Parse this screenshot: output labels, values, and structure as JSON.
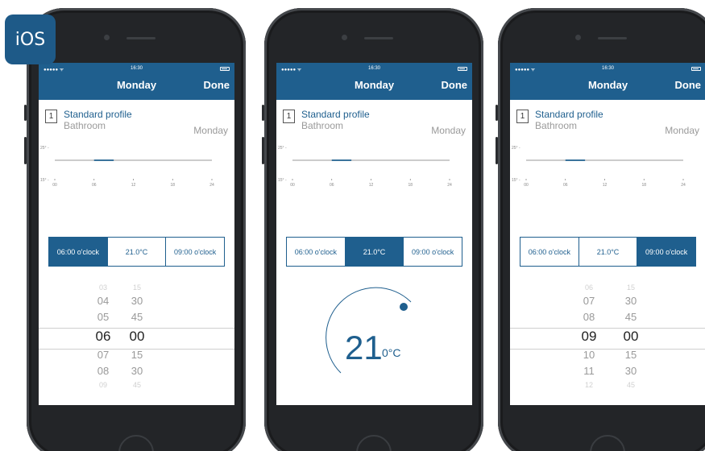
{
  "badge": {
    "label": "iOS"
  },
  "status_time": "16:30",
  "nav": {
    "title": "Monday",
    "done_label": "Done"
  },
  "profile": {
    "number": "1",
    "name": "Standard profile",
    "room": "Bathroom",
    "day": "Monday"
  },
  "graph": {
    "y_labels": [
      "25°",
      "15°"
    ],
    "x_labels": [
      "00",
      "06",
      "12",
      "18",
      "24"
    ],
    "setpoint_c": 21.0,
    "highlight_hours": [
      6,
      9
    ]
  },
  "segment": {
    "start": "06:00 o'clock",
    "temp": "21.0°C",
    "end": "09:00 o'clock"
  },
  "phones": [
    {
      "active_segment": "start",
      "picker": {
        "hours": [
          "03",
          "04",
          "05",
          "06",
          "07",
          "08",
          "09"
        ],
        "minutes": [
          "15",
          "30",
          "45",
          "00",
          "15",
          "30",
          "45"
        ]
      }
    },
    {
      "active_segment": "temp",
      "dial": {
        "value": "21",
        "unit": "0°C"
      }
    },
    {
      "active_segment": "end",
      "picker": {
        "hours": [
          "06",
          "07",
          "08",
          "09",
          "10",
          "11",
          "12"
        ],
        "minutes": [
          "15",
          "30",
          "45",
          "00",
          "15",
          "30",
          "45"
        ]
      }
    }
  ],
  "colors": {
    "accent": "#1f5f8e",
    "phone_body": "#232528"
  }
}
